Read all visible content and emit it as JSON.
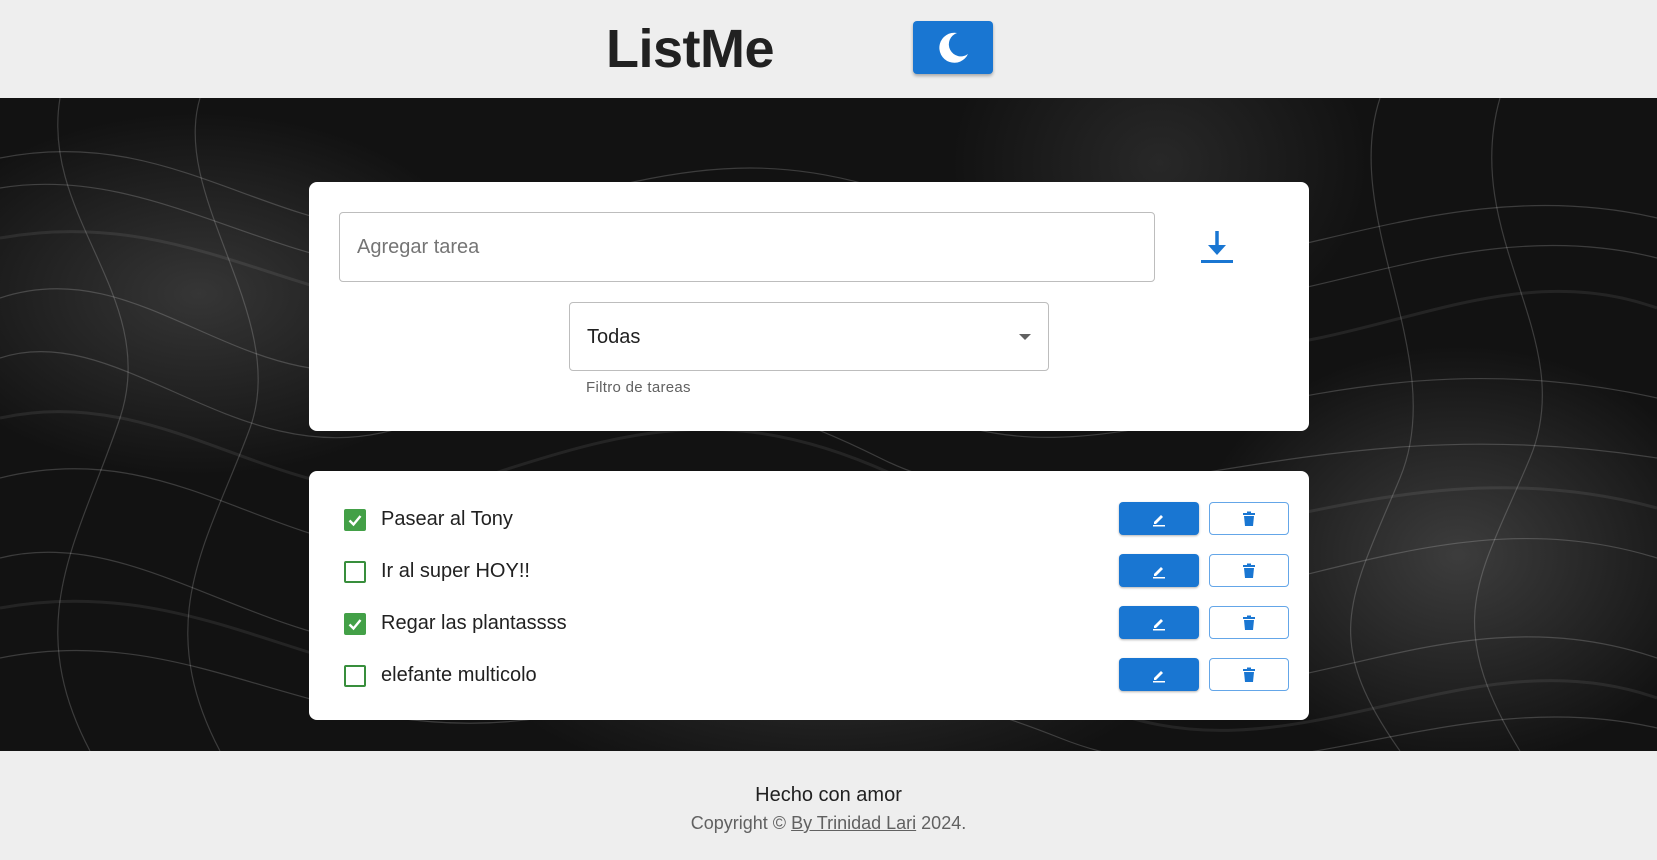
{
  "header": {
    "title": "ListMe",
    "theme_toggle_icon": "moon-icon"
  },
  "add_task": {
    "placeholder": "Agregar tarea",
    "value": "",
    "submit_icon": "download-arrow-icon"
  },
  "filter": {
    "selected": "Todas",
    "helper": "Filtro de tareas"
  },
  "tasks": [
    {
      "label": "Pasear al Tony",
      "done": true
    },
    {
      "label": "Ir al super HOY!!",
      "done": false
    },
    {
      "label": "Regar las plantassss",
      "done": true
    },
    {
      "label": "elefante multicolo",
      "done": false
    }
  ],
  "task_actions": {
    "edit_icon": "pencil-icon",
    "delete_icon": "trash-icon"
  },
  "footer": {
    "title": "Hecho con amor",
    "copyright_prefix": "Copyright ©",
    "author_link": "By Trinidad Lari",
    "year_suffix": "2024."
  },
  "colors": {
    "primary": "#1976d2",
    "check_green": "#43a047",
    "page_bg": "#eeeeee",
    "stage_bg": "#121212"
  }
}
